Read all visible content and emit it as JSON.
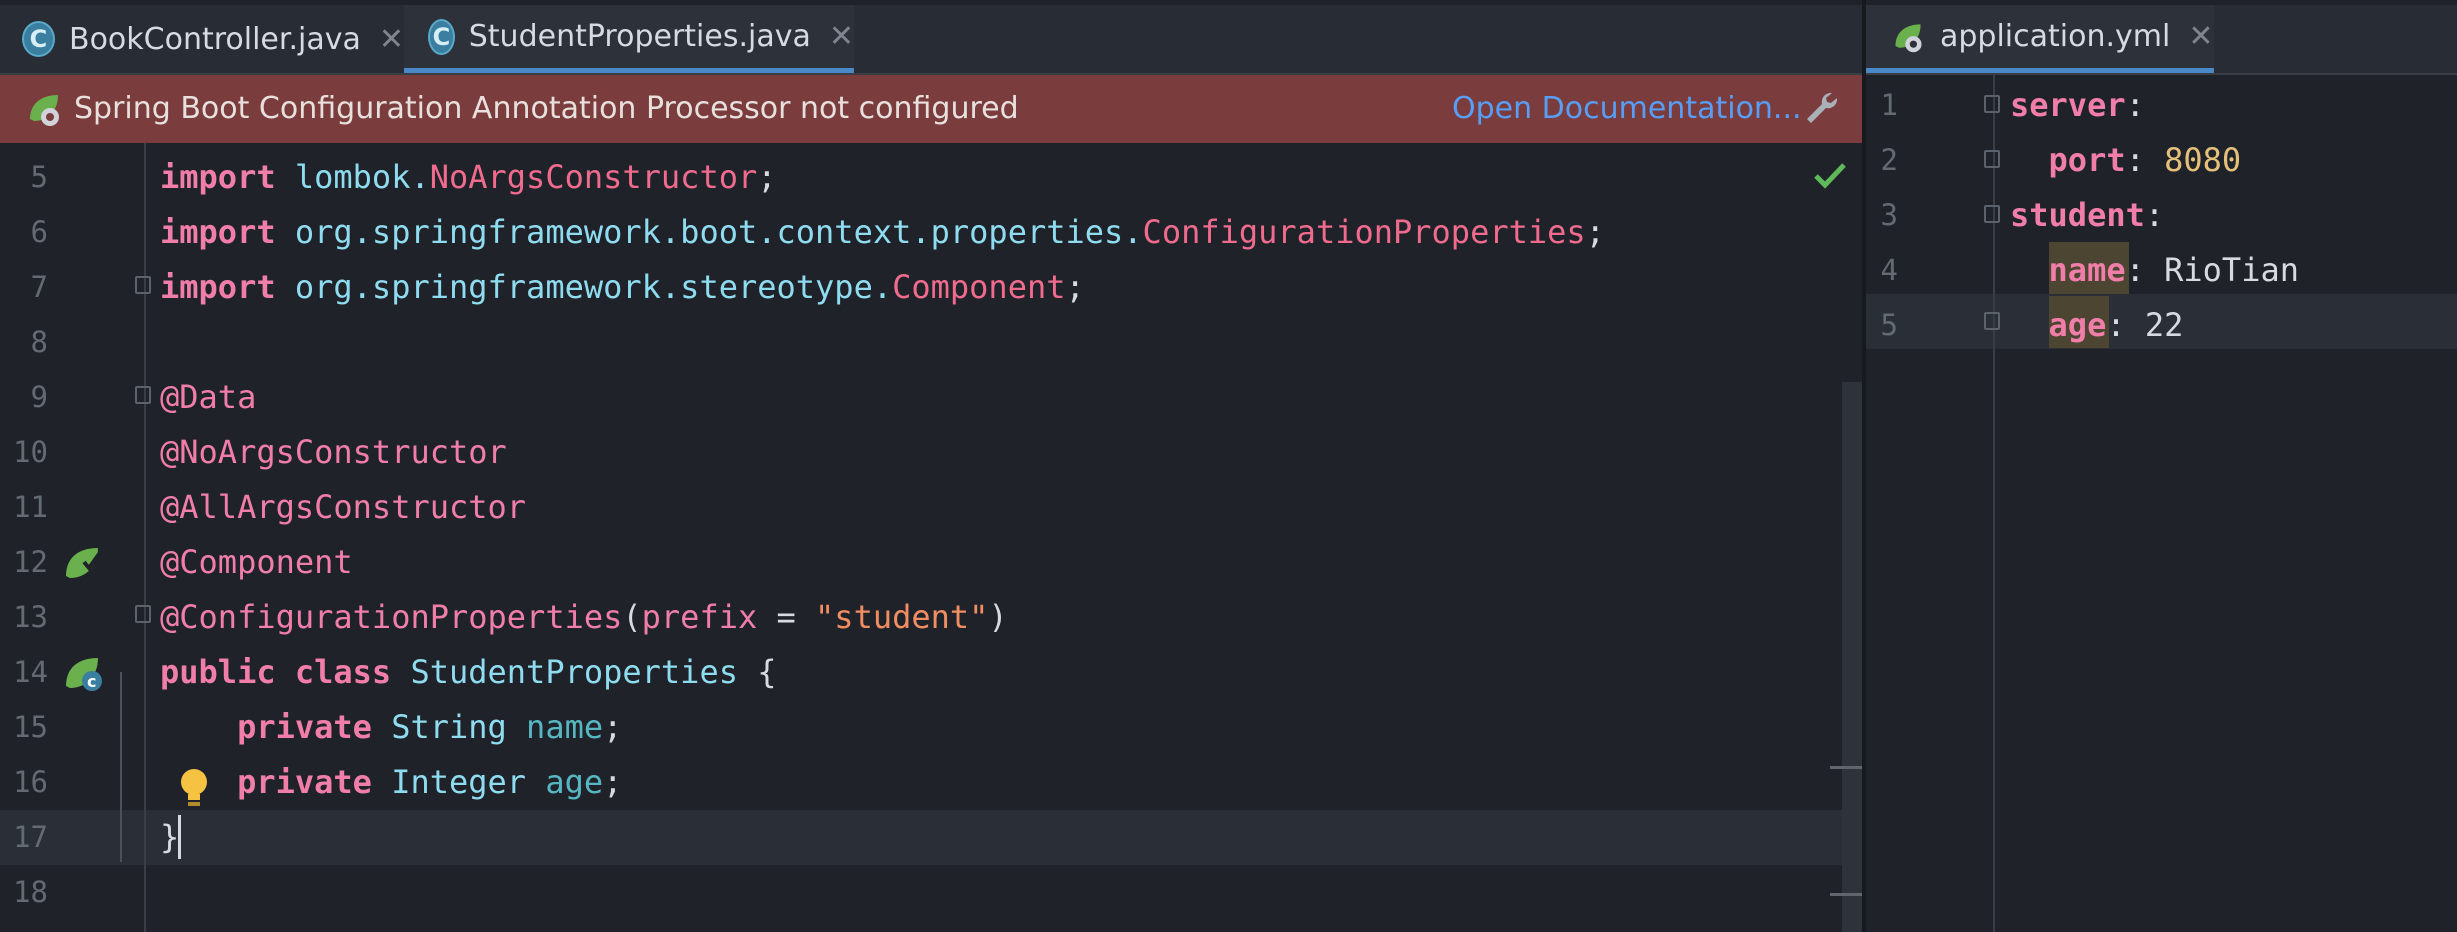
{
  "tabs_left": [
    {
      "label": "BookController.java",
      "active": false
    },
    {
      "label": "StudentProperties.java",
      "active": true
    }
  ],
  "tabs_right": [
    {
      "label": "application.yml",
      "active": true
    }
  ],
  "banner": {
    "message": "Spring Boot Configuration Annotation Processor not configured",
    "link": "Open Documentation..."
  },
  "java_editor": {
    "lines": [
      {
        "num": "5",
        "tokens": [
          {
            "t": "import",
            "c": "kw"
          },
          {
            "t": " lombok.",
            "c": "pkg"
          },
          {
            "t": "NoArgsConstructor",
            "c": "cls"
          },
          {
            "t": ";",
            "c": "plain"
          }
        ]
      },
      {
        "num": "6",
        "tokens": [
          {
            "t": "import",
            "c": "kw"
          },
          {
            "t": " org.springframework.boot.context.properties.",
            "c": "pkg"
          },
          {
            "t": "ConfigurationProperties",
            "c": "cls"
          },
          {
            "t": ";",
            "c": "plain"
          }
        ]
      },
      {
        "num": "7",
        "tokens": [
          {
            "t": "import",
            "c": "kw"
          },
          {
            "t": " org.springframework.stereotype.",
            "c": "pkg"
          },
          {
            "t": "Component",
            "c": "cls"
          },
          {
            "t": ";",
            "c": "plain"
          }
        ]
      },
      {
        "num": "8",
        "tokens": []
      },
      {
        "num": "9",
        "tokens": [
          {
            "t": "@Data",
            "c": "ann"
          }
        ]
      },
      {
        "num": "10",
        "tokens": [
          {
            "t": "@NoArgsConstructor",
            "c": "ann"
          }
        ]
      },
      {
        "num": "11",
        "tokens": [
          {
            "t": "@AllArgsConstructor",
            "c": "ann"
          }
        ]
      },
      {
        "num": "12",
        "tokens": [
          {
            "t": "@Component",
            "c": "ann"
          }
        ]
      },
      {
        "num": "13",
        "tokens": [
          {
            "t": "@ConfigurationProperties",
            "c": "ann"
          },
          {
            "t": "(",
            "c": "plain"
          },
          {
            "t": "prefix",
            "c": "ann"
          },
          {
            "t": " = ",
            "c": "plain"
          },
          {
            "t": "\"student\"",
            "c": "str"
          },
          {
            "t": ")",
            "c": "plain"
          }
        ]
      },
      {
        "num": "14",
        "tokens": [
          {
            "t": "public class",
            "c": "kw"
          },
          {
            "t": " StudentProperties ",
            "c": "type"
          },
          {
            "t": "{",
            "c": "plain"
          }
        ]
      },
      {
        "num": "15",
        "tokens": [
          {
            "t": "    private",
            "c": "kw"
          },
          {
            "t": " String ",
            "c": "type"
          },
          {
            "t": "name",
            "c": "fld"
          },
          {
            "t": ";",
            "c": "plain"
          }
        ]
      },
      {
        "num": "16",
        "tokens": [
          {
            "t": "    private",
            "c": "kw"
          },
          {
            "t": " Integer ",
            "c": "type"
          },
          {
            "t": "age",
            "c": "fld"
          },
          {
            "t": ";",
            "c": "plain"
          }
        ]
      },
      {
        "num": "17",
        "tokens": [
          {
            "t": "}",
            "c": "plain"
          }
        ]
      },
      {
        "num": "18",
        "tokens": []
      }
    ]
  },
  "yaml_editor": {
    "lines": [
      {
        "num": "1",
        "tokens": [
          {
            "t": "server",
            "c": "ykey"
          },
          {
            "t": ":",
            "c": "plain"
          }
        ]
      },
      {
        "num": "2",
        "tokens": [
          {
            "t": "  port",
            "c": "ykey"
          },
          {
            "t": ": ",
            "c": "plain"
          },
          {
            "t": "8080",
            "c": "ynum"
          }
        ]
      },
      {
        "num": "3",
        "tokens": [
          {
            "t": "student",
            "c": "ykey"
          },
          {
            "t": ":",
            "c": "plain"
          }
        ]
      },
      {
        "num": "4",
        "tokens": [
          {
            "t": "  name",
            "c": "ykey"
          },
          {
            "t": ": RioTian",
            "c": "plain"
          }
        ]
      },
      {
        "num": "5",
        "tokens": [
          {
            "t": "  age",
            "c": "ykey"
          },
          {
            "t": ": 22",
            "c": "plain"
          }
        ]
      }
    ]
  },
  "colors": {
    "accent": "#4a88c7",
    "banner_bg": "#7a3c3c",
    "link": "#589df6",
    "spring_green": "#6ab04c",
    "bulb": "#f5c242"
  },
  "icons": [
    "class-icon",
    "close-icon",
    "spring-icon",
    "wrench-icon",
    "checkmark-icon",
    "spring-bean-icon",
    "bulb-icon",
    "fold-icon"
  ]
}
